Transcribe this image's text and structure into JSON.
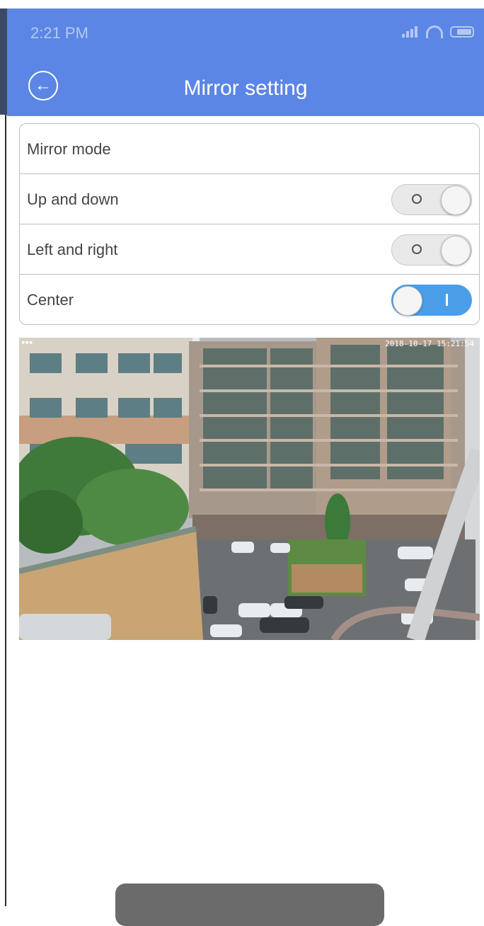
{
  "status_bar": {
    "time": "2:21 PM"
  },
  "header": {
    "title": "Mirror setting"
  },
  "settings": {
    "section_label": "Mirror mode",
    "rows": [
      {
        "label": "Up and down",
        "state": "off"
      },
      {
        "label": "Left and right",
        "state": "off"
      },
      {
        "label": "Center",
        "state": "on"
      }
    ]
  },
  "preview": {
    "timestamp": "2018-10-17 15:21:54"
  },
  "colors": {
    "accent": "#5b86e5",
    "toggle_on": "#4a9ee8"
  },
  "icons": {
    "back": "back-arrow-circle-icon"
  }
}
